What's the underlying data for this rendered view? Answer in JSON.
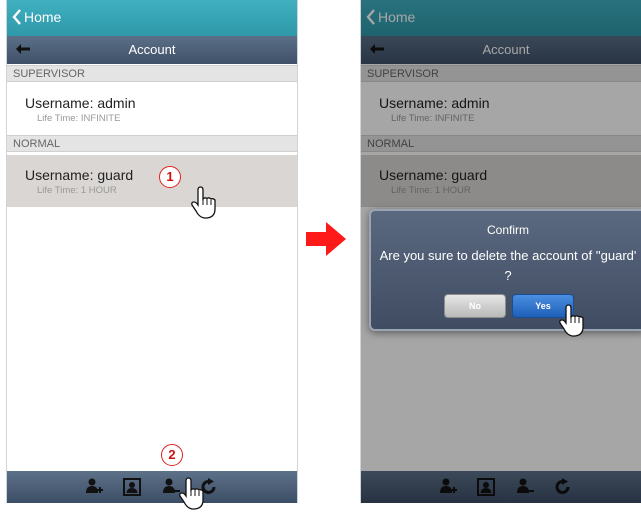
{
  "colors": {
    "status_bar": "#35a3b5",
    "nav_bar": "#4a5d76",
    "selected_row": "#d9d6d3",
    "step_marker": "#e02020",
    "arrow": "#ff1a1a",
    "yes_button": "#2a6fca"
  },
  "left": {
    "status": {
      "home_label": "Home"
    },
    "nav": {
      "title": "Account"
    },
    "sections": [
      {
        "label": "SUPERVISOR"
      },
      {
        "label": "NORMAL"
      }
    ],
    "accounts": [
      {
        "username": "Username: admin",
        "lifetime": "Life Time: INFINITE"
      },
      {
        "username": "Username: guard",
        "lifetime": "Life Time: 1 HOUR"
      }
    ],
    "toolbar": {
      "icons": [
        "add-user-icon",
        "user-profile-icon",
        "remove-user-icon",
        "refresh-icon"
      ]
    },
    "steps": [
      "1",
      "2"
    ]
  },
  "right": {
    "status": {
      "home_label": "Home"
    },
    "nav": {
      "title": "Account"
    },
    "sections": [
      {
        "label": "SUPERVISOR"
      },
      {
        "label": "NORMAL"
      }
    ],
    "accounts": [
      {
        "username": "Username: admin",
        "lifetime": "Life Time: INFINITE"
      },
      {
        "username": "Username: guard",
        "lifetime": "Life Time: 1 HOUR"
      }
    ],
    "dialog": {
      "title": "Confirm",
      "message": "Are you sure to delete the account of ''guard' ?",
      "no_label": "No",
      "yes_label": "Yes"
    }
  }
}
